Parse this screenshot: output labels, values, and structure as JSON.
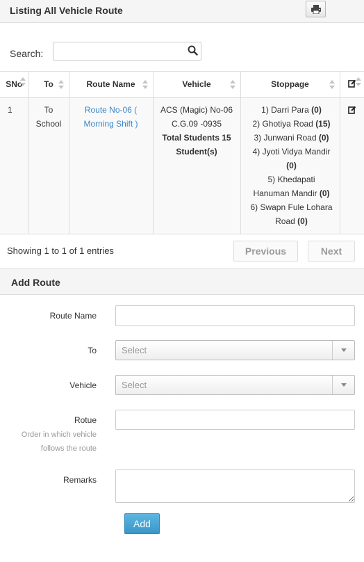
{
  "header": {
    "title": "Listing All Vehicle Route",
    "print_icon": "printer-icon"
  },
  "search": {
    "label": "Search:",
    "value": "",
    "icon": "search-icon"
  },
  "table": {
    "columns": [
      "SNo",
      "To",
      "Route Name",
      "Vehicle",
      "Stoppage"
    ],
    "rows": [
      {
        "sno": "1",
        "to": "To School",
        "route_name": "Route No-06 ( Morning Shift )",
        "vehicle": "ACS (Magic) No-06 C.G.09 -0935",
        "total_students": "Total Students 15 Student(s)",
        "stoppages": [
          {
            "name": "1) Darri Para",
            "count": "(0)"
          },
          {
            "name": "2) Ghotiya Road",
            "count": "(15)"
          },
          {
            "name": "3) Junwani Road",
            "count": "(0)"
          },
          {
            "name": "4) Jyoti Vidya Mandir",
            "count": "(0)"
          },
          {
            "name": "5) Khedapati Hanuman Mandir",
            "count": "(0)"
          },
          {
            "name": "6) Swapn Fule Lohara Road",
            "count": "(0)"
          }
        ]
      }
    ]
  },
  "pagination": {
    "info": "Showing 1 to 1 of 1 entries",
    "previous": "Previous",
    "next": "Next"
  },
  "add_route": {
    "title": "Add Route",
    "route_name_label": "Route Name",
    "to_label": "To",
    "to_value": "Select",
    "vehicle_label": "Vehicle",
    "vehicle_value": "Select",
    "rotue_label": "Rotue",
    "rotue_help": "Order in which vehicle follows the route",
    "remarks_label": "Remarks",
    "add_button": "Add"
  },
  "colors": {
    "link": "#3a87c8",
    "primary_button": "#3b96c9"
  }
}
